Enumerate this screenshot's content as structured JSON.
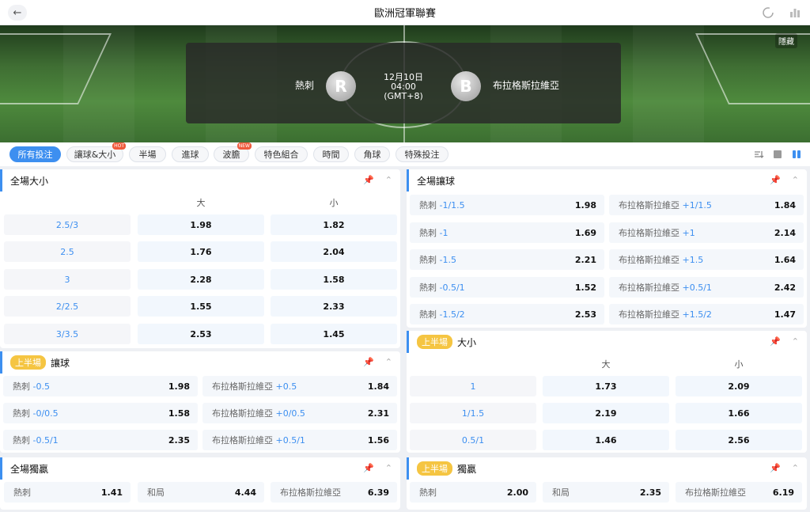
{
  "header": {
    "title": "歐洲冠軍聯賽",
    "back_icon": "back-arrow-icon",
    "right_icons": [
      "refresh-icon",
      "stats-icon"
    ]
  },
  "hero": {
    "hide_label": "隱藏",
    "home_team": "熱刺",
    "home_badge": "R",
    "away_team": "布拉格斯拉維亞",
    "away_badge": "B",
    "date": "12月10日",
    "time": "04:00",
    "tz": "(GMT+8)"
  },
  "tabs": [
    {
      "label": "所有投注",
      "active": true
    },
    {
      "label": "讓球&大小",
      "hot": "HOT"
    },
    {
      "label": "半場"
    },
    {
      "label": "進球"
    },
    {
      "label": "波膽",
      "hot": "NEW"
    },
    {
      "label": "特色組合"
    },
    {
      "label": "時間"
    },
    {
      "label": "角球"
    },
    {
      "label": "特殊投注"
    }
  ],
  "panels": {
    "ft_ou": {
      "title": "全場大小",
      "col_over": "大",
      "col_under": "小",
      "rows": [
        {
          "line": "2.5/3",
          "over": "1.98",
          "under": "1.82"
        },
        {
          "line": "2.5",
          "over": "1.76",
          "under": "2.04"
        },
        {
          "line": "3",
          "over": "2.28",
          "under": "1.58"
        },
        {
          "line": "2/2.5",
          "over": "1.55",
          "under": "2.33"
        },
        {
          "line": "3/3.5",
          "over": "2.53",
          "under": "1.45"
        }
      ]
    },
    "ft_hdp": {
      "title": "全場讓球",
      "rows": [
        {
          "home": "熱刺",
          "home_hc": "-1/1.5",
          "home_odd": "1.98",
          "away": "布拉格斯拉維亞",
          "away_hc": "+1/1.5",
          "away_odd": "1.84"
        },
        {
          "home": "熱刺",
          "home_hc": "-1",
          "home_odd": "1.69",
          "away": "布拉格斯拉維亞",
          "away_hc": "+1",
          "away_odd": "2.14"
        },
        {
          "home": "熱刺",
          "home_hc": "-1.5",
          "home_odd": "2.21",
          "away": "布拉格斯拉維亞",
          "away_hc": "+1.5",
          "away_odd": "1.64"
        },
        {
          "home": "熱刺",
          "home_hc": "-0.5/1",
          "home_odd": "1.52",
          "away": "布拉格斯拉維亞",
          "away_hc": "+0.5/1",
          "away_odd": "2.42"
        },
        {
          "home": "熱刺",
          "home_hc": "-1.5/2",
          "home_odd": "2.53",
          "away": "布拉格斯拉維亞",
          "away_hc": "+1.5/2",
          "away_odd": "1.47"
        }
      ]
    },
    "ht_hdp": {
      "tag": "上半場",
      "title": "讓球",
      "rows": [
        {
          "home": "熱刺",
          "home_hc": "-0.5",
          "home_odd": "1.98",
          "away": "布拉格斯拉維亞",
          "away_hc": "+0.5",
          "away_odd": "1.84"
        },
        {
          "home": "熱刺",
          "home_hc": "-0/0.5",
          "home_odd": "1.58",
          "away": "布拉格斯拉維亞",
          "away_hc": "+0/0.5",
          "away_odd": "2.31"
        },
        {
          "home": "熱刺",
          "home_hc": "-0.5/1",
          "home_odd": "2.35",
          "away": "布拉格斯拉維亞",
          "away_hc": "+0.5/1",
          "away_odd": "1.56"
        }
      ]
    },
    "ht_ou": {
      "tag": "上半場",
      "title": "大小",
      "col_over": "大",
      "col_under": "小",
      "rows": [
        {
          "line": "1",
          "over": "1.73",
          "under": "2.09"
        },
        {
          "line": "1/1.5",
          "over": "2.19",
          "under": "1.66"
        },
        {
          "line": "0.5/1",
          "over": "1.46",
          "under": "2.56"
        }
      ]
    },
    "ft_1x2": {
      "title": "全場獨贏",
      "home": "熱刺",
      "home_odd": "1.41",
      "draw": "和局",
      "draw_odd": "4.44",
      "away": "布拉格斯拉維亞",
      "away_odd": "6.39"
    },
    "ht_1x2": {
      "tag": "上半場",
      "title": "獨贏",
      "home": "熱刺",
      "home_odd": "2.00",
      "draw": "和局",
      "draw_odd": "2.35",
      "away": "布拉格斯拉維亞",
      "away_odd": "6.19"
    }
  },
  "colors": {
    "accent": "#3d8ff0",
    "tag": "#f5c542",
    "hot": "#f05a3c"
  }
}
